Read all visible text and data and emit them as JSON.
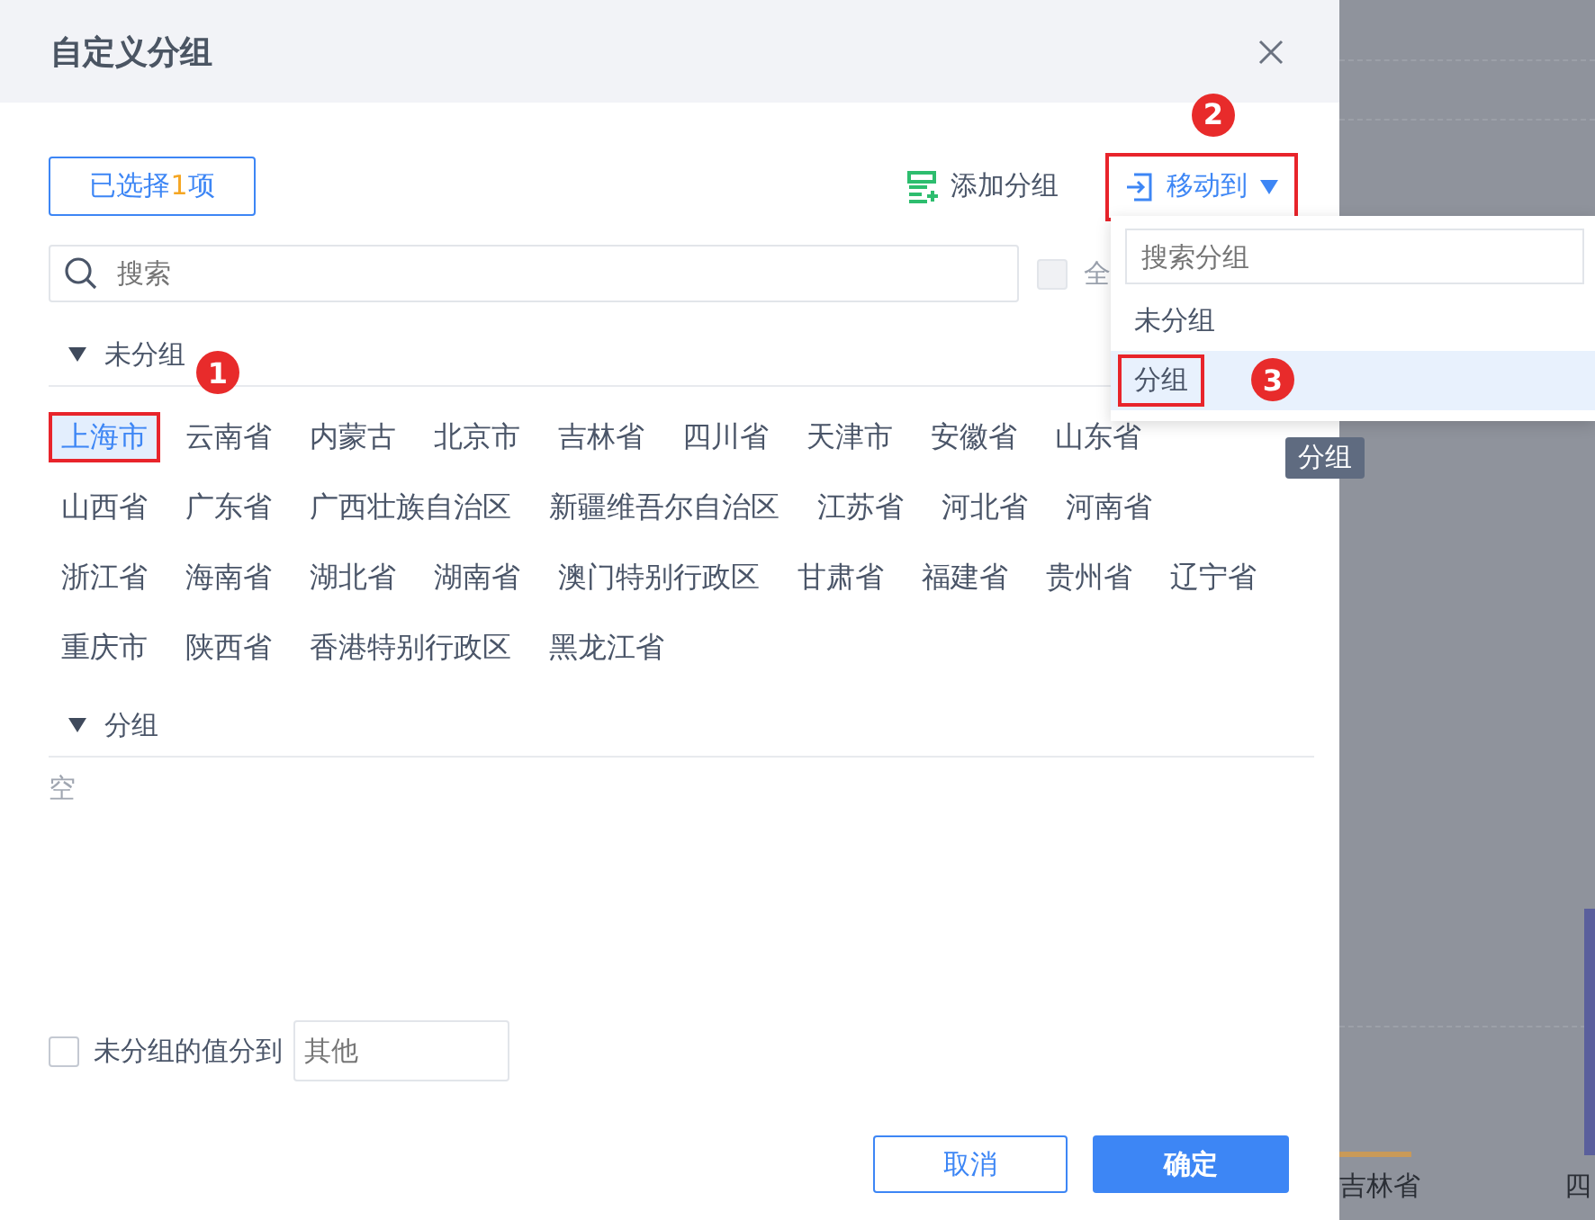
{
  "dialog": {
    "title": "自定义分组"
  },
  "toolbar": {
    "selected_count": {
      "before": "已选择",
      "count": "1",
      "after": "项"
    },
    "add_group": "添加分组",
    "move_to": {
      "label": "移动到",
      "marker": "2"
    }
  },
  "search": {
    "placeholder": "搜索"
  },
  "select_all": {
    "label": "全",
    "checked": false
  },
  "sections": [
    {
      "title": "未分组",
      "expanded": true,
      "items": [
        {
          "label": "上海市",
          "selected": true,
          "marker": "1"
        },
        {
          "label": "云南省",
          "selected": false
        },
        {
          "label": "内蒙古",
          "selected": false
        },
        {
          "label": "北京市",
          "selected": false
        },
        {
          "label": "吉林省",
          "selected": false
        },
        {
          "label": "四川省",
          "selected": false
        },
        {
          "label": "天津市",
          "selected": false
        },
        {
          "label": "安徽省",
          "selected": false
        },
        {
          "label": "山东省",
          "selected": false
        },
        {
          "label": "山西省",
          "selected": false
        },
        {
          "label": "广东省",
          "selected": false
        },
        {
          "label": "广西壮族自治区",
          "selected": false
        },
        {
          "label": "新疆维吾尔自治区",
          "selected": false
        },
        {
          "label": "江苏省",
          "selected": false
        },
        {
          "label": "河北省",
          "selected": false
        },
        {
          "label": "河南省",
          "selected": false
        },
        {
          "label": "浙江省",
          "selected": false
        },
        {
          "label": "海南省",
          "selected": false
        },
        {
          "label": "湖北省",
          "selected": false
        },
        {
          "label": "湖南省",
          "selected": false
        },
        {
          "label": "澳门特别行政区",
          "selected": false
        },
        {
          "label": "甘肃省",
          "selected": false
        },
        {
          "label": "福建省",
          "selected": false
        },
        {
          "label": "贵州省",
          "selected": false
        },
        {
          "label": "辽宁省",
          "selected": false
        },
        {
          "label": "重庆市",
          "selected": false
        },
        {
          "label": "陕西省",
          "selected": false
        },
        {
          "label": "香港特别行政区",
          "selected": false
        },
        {
          "label": "黑龙江省",
          "selected": false
        }
      ]
    },
    {
      "title": "分组",
      "expanded": true,
      "empty_text": "空"
    }
  ],
  "unassigned": {
    "label": "未分组的值分到",
    "checked": false,
    "placeholder": "其他"
  },
  "buttons": {
    "cancel": "取消",
    "ok": "确定"
  },
  "dropdown": {
    "search_placeholder": "搜索分组",
    "items": [
      {
        "label": "未分组",
        "selected": false
      },
      {
        "label": "分组",
        "selected": true,
        "marker": "3"
      }
    ]
  },
  "tooltip": "分组",
  "background_chart": {
    "labels": [
      "吉林省",
      "四"
    ]
  }
}
